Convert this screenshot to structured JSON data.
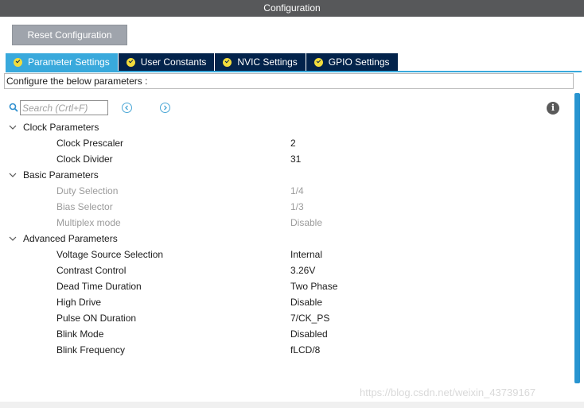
{
  "window": {
    "title": "Configuration"
  },
  "toolbar": {
    "reset_label": "Reset Configuration"
  },
  "tabs": [
    {
      "label": "Parameter Settings",
      "active": true,
      "icon": "check-circle-icon"
    },
    {
      "label": "User Constants",
      "active": false,
      "icon": "check-circle-icon"
    },
    {
      "label": "NVIC Settings",
      "active": false,
      "icon": "check-circle-icon"
    },
    {
      "label": "GPIO Settings",
      "active": false,
      "icon": "check-circle-icon"
    }
  ],
  "description": "Configure the below parameters :",
  "search": {
    "placeholder": "Search (Crtl+F)",
    "value": ""
  },
  "groups": [
    {
      "label": "Clock Parameters",
      "params": [
        {
          "name": "Clock Prescaler",
          "value": "2",
          "enabled": true
        },
        {
          "name": "Clock Divider",
          "value": "31",
          "enabled": true
        }
      ]
    },
    {
      "label": "Basic Parameters",
      "params": [
        {
          "name": "Duty Selection",
          "value": "1/4",
          "enabled": false
        },
        {
          "name": "Bias Selector",
          "value": "1/3",
          "enabled": false
        },
        {
          "name": "Multiplex mode",
          "value": "Disable",
          "enabled": false
        }
      ]
    },
    {
      "label": "Advanced Parameters",
      "params": [
        {
          "name": "Voltage Source Selection",
          "value": "Internal",
          "enabled": true
        },
        {
          "name": "Contrast Control",
          "value": "3.26V",
          "enabled": true
        },
        {
          "name": "Dead Time Duration",
          "value": "Two Phase",
          "enabled": true
        },
        {
          "name": "High Drive",
          "value": "Disable",
          "enabled": true
        },
        {
          "name": "Pulse ON Duration",
          "value": "7/CK_PS",
          "enabled": true
        },
        {
          "name": "Blink Mode",
          "value": "Disabled",
          "enabled": true
        },
        {
          "name": "Blink Frequency",
          "value": "fLCD/8",
          "enabled": true
        }
      ]
    }
  ],
  "watermark": "https://blog.csdn.net/weixin_43739167",
  "colors": {
    "title_bar": "#57585a",
    "tab_active": "#39a9dc",
    "tab_inactive": "#03234b",
    "check_badge": "#f2dc3c",
    "scrollbar": "#2894d0"
  }
}
